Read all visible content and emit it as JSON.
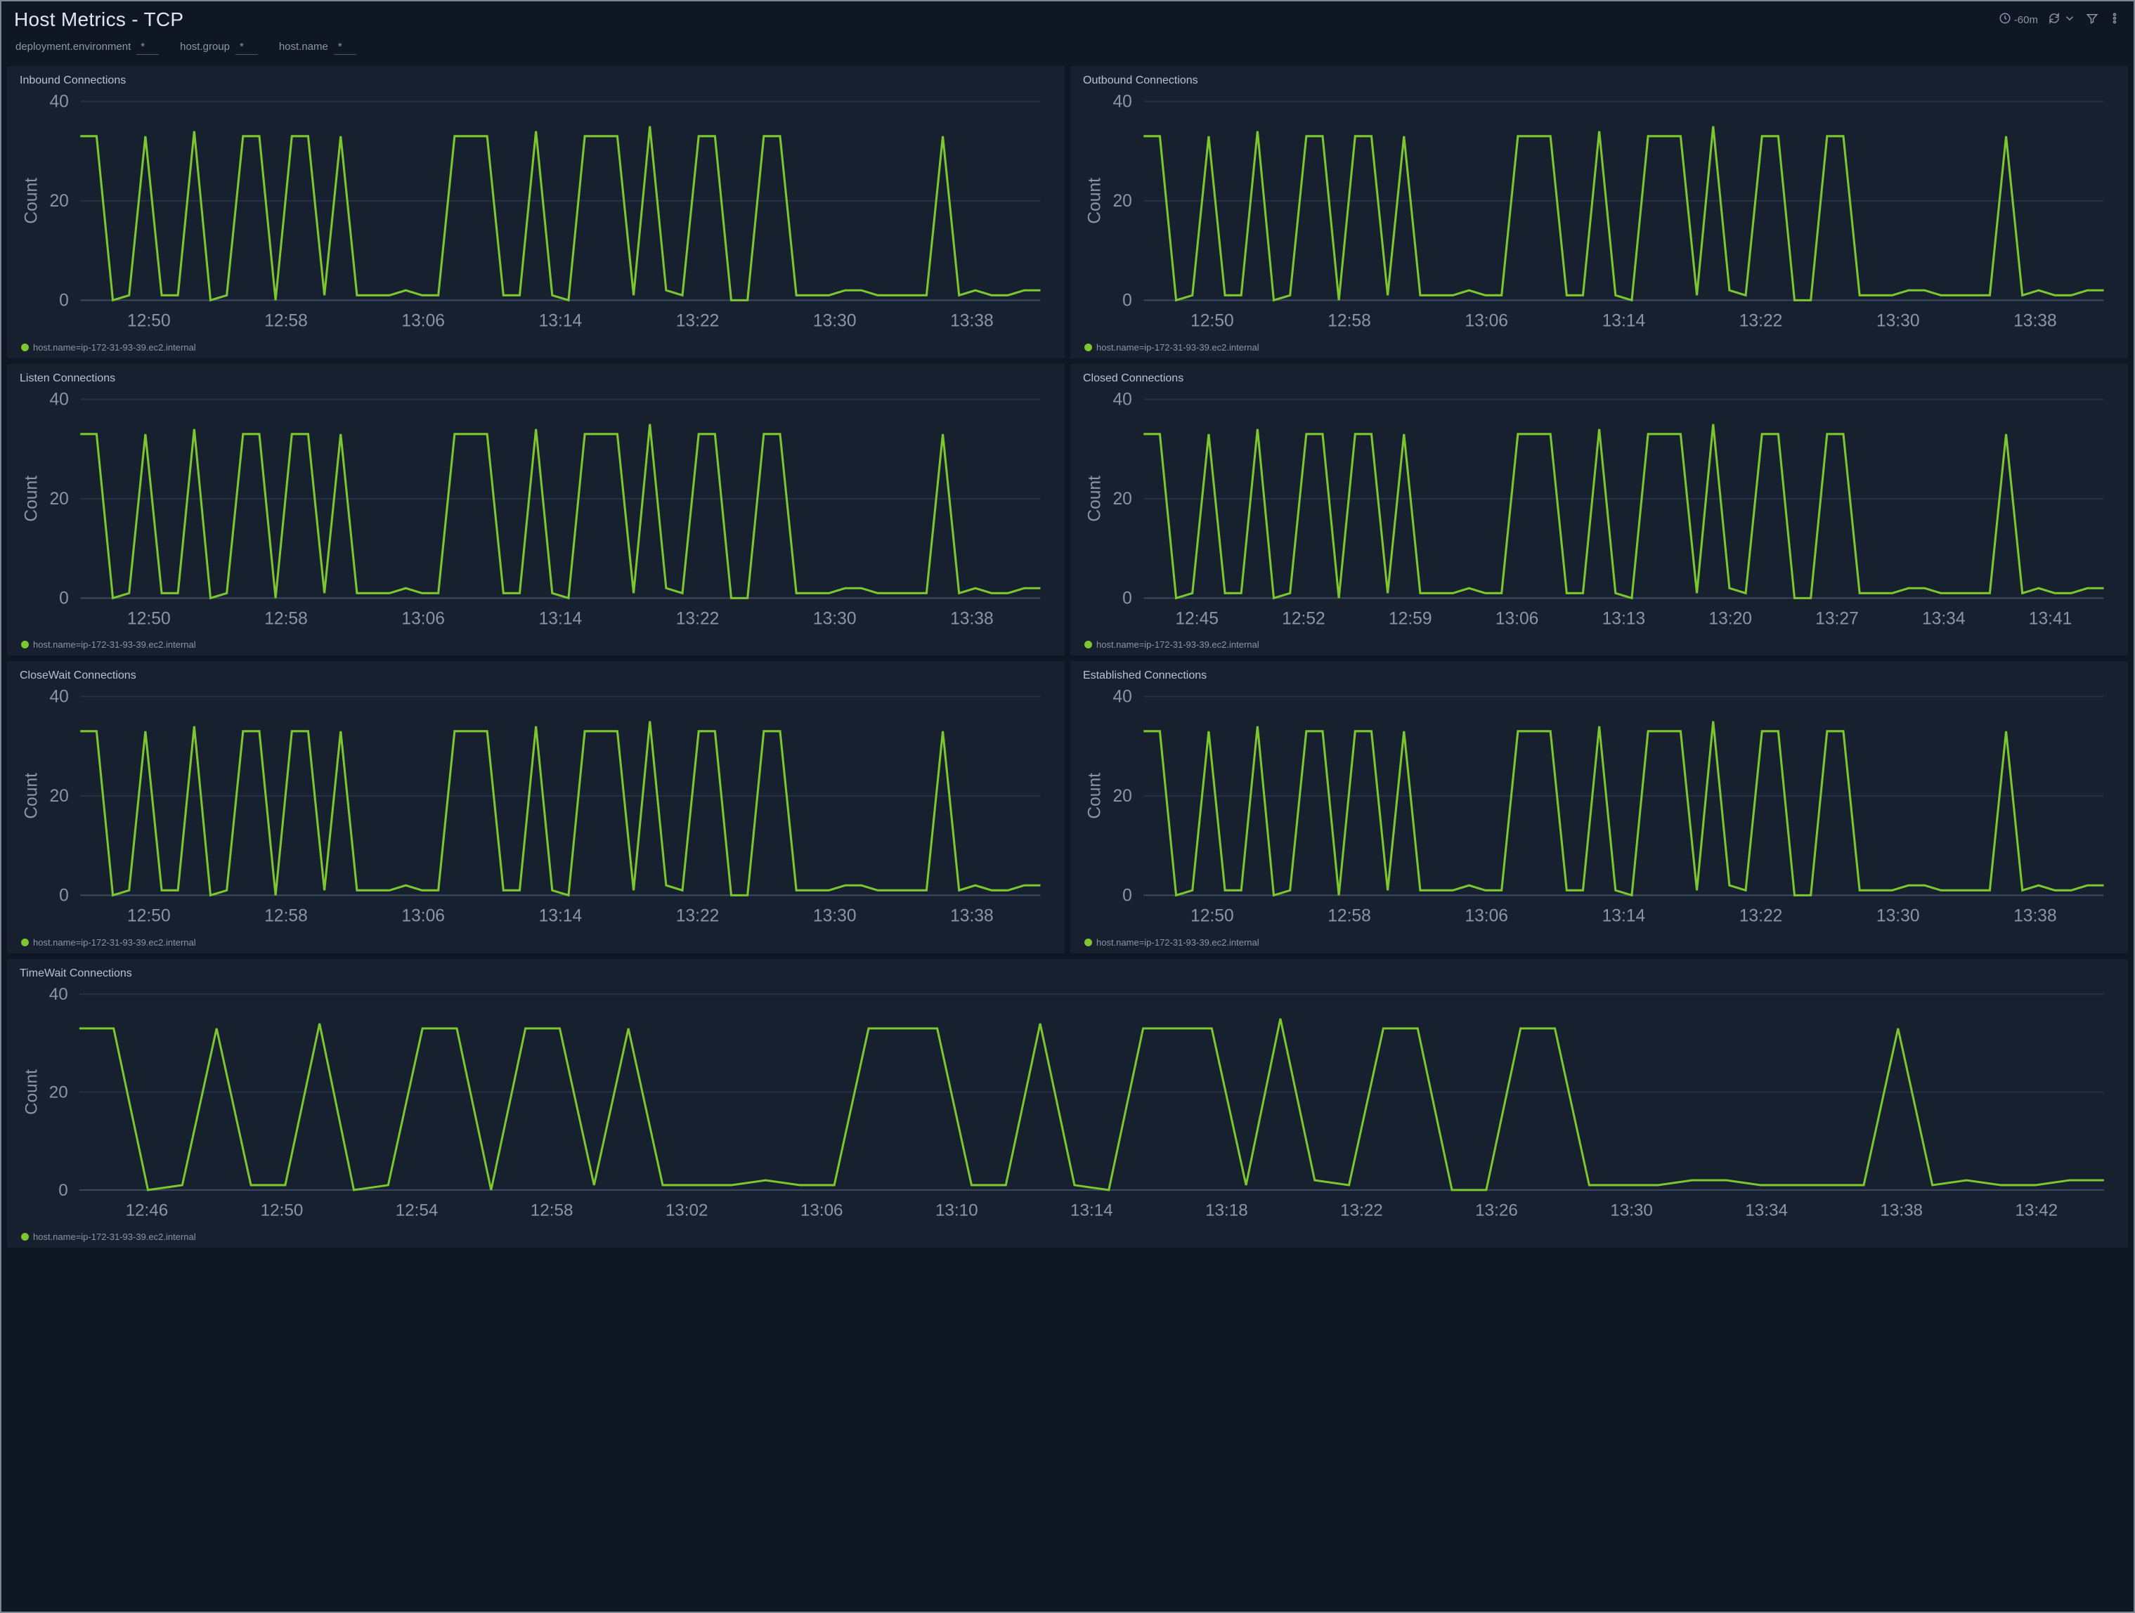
{
  "header": {
    "title": "Host Metrics - TCP",
    "time_range": "-60m"
  },
  "filters": [
    {
      "label": "deployment.environment",
      "value": "*"
    },
    {
      "label": "host.group",
      "value": "*"
    },
    {
      "label": "host.name",
      "value": "*"
    }
  ],
  "legend_label": "host.name=ip-172-31-93-39.ec2.internal",
  "panels": [
    {
      "id": "inbound",
      "title": "Inbound Connections",
      "full": false,
      "data_key": "series_a",
      "ticks_key": "ticks_a"
    },
    {
      "id": "outbound",
      "title": "Outbound Connections",
      "full": false,
      "data_key": "series_a",
      "ticks_key": "ticks_a"
    },
    {
      "id": "listen",
      "title": "Listen Connections",
      "full": false,
      "data_key": "series_a",
      "ticks_key": "ticks_a"
    },
    {
      "id": "closed",
      "title": "Closed Connections",
      "full": false,
      "data_key": "series_a",
      "ticks_key": "ticks_b"
    },
    {
      "id": "closewait",
      "title": "CloseWait Connections",
      "full": false,
      "data_key": "series_a",
      "ticks_key": "ticks_a"
    },
    {
      "id": "established",
      "title": "Established Connections",
      "full": false,
      "data_key": "series_a",
      "ticks_key": "ticks_a"
    },
    {
      "id": "timewait",
      "title": "TimeWait Connections",
      "full": true,
      "data_key": "series_a",
      "ticks_key": "ticks_c"
    }
  ],
  "chart_data": {
    "type": "line",
    "ylabel": "Count",
    "ylim": [
      0,
      40
    ],
    "yticks": [
      0,
      20,
      40
    ],
    "series_color": "#7cc62e",
    "series_name": "host.name=ip-172-31-93-39.ec2.internal",
    "x": [
      0,
      1,
      2,
      3,
      4,
      5,
      6,
      7,
      8,
      9,
      10,
      11,
      12,
      13,
      14,
      15,
      16,
      17,
      18,
      19,
      20,
      21,
      22,
      23,
      24,
      25,
      26,
      27,
      28,
      29,
      30,
      31,
      32,
      33,
      34,
      35,
      36,
      37,
      38,
      39,
      40,
      41,
      42,
      43,
      44,
      45,
      46,
      47,
      48,
      49,
      50,
      51,
      52,
      53,
      54,
      55,
      56,
      57,
      58,
      59
    ],
    "series_a": [
      33,
      33,
      0,
      1,
      33,
      1,
      1,
      34,
      0,
      1,
      33,
      33,
      0,
      33,
      33,
      1,
      33,
      1,
      1,
      1,
      2,
      1,
      1,
      33,
      33,
      33,
      1,
      1,
      34,
      1,
      0,
      33,
      33,
      33,
      1,
      35,
      2,
      1,
      33,
      33,
      0,
      0,
      33,
      33,
      1,
      1,
      1,
      2,
      2,
      1,
      1,
      1,
      1,
      33,
      1,
      2,
      1,
      1,
      2,
      2
    ],
    "ticks_a": [
      "12:50",
      "12:58",
      "13:06",
      "13:14",
      "13:22",
      "13:30",
      "13:38"
    ],
    "ticks_b": [
      "12:45",
      "12:52",
      "12:59",
      "13:06",
      "13:13",
      "13:20",
      "13:27",
      "13:34",
      "13:41"
    ],
    "ticks_c": [
      "12:46",
      "12:50",
      "12:54",
      "12:58",
      "13:02",
      "13:06",
      "13:10",
      "13:14",
      "13:18",
      "13:22",
      "13:26",
      "13:30",
      "13:34",
      "13:38",
      "13:42"
    ]
  }
}
